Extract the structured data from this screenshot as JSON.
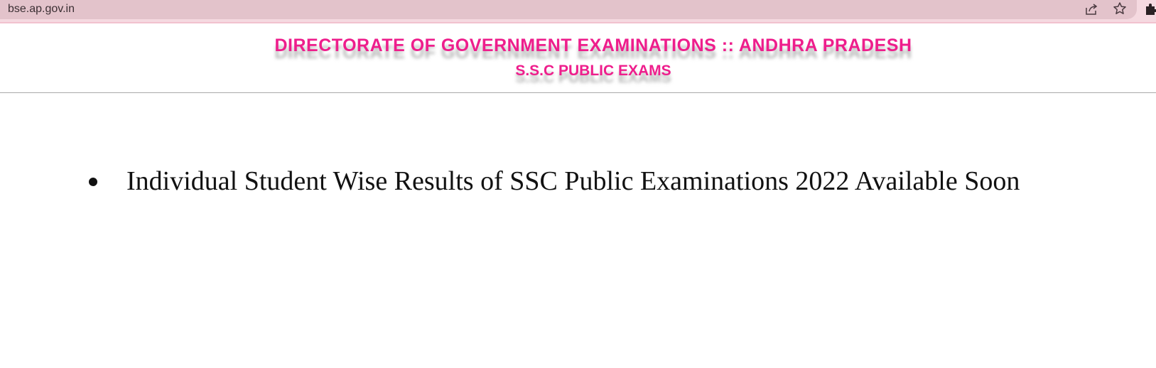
{
  "browser": {
    "url": "bse.ap.gov.in",
    "icons": [
      "lock-icon",
      "share-icon",
      "star-icon",
      "extension-icon"
    ],
    "bar_color": "#f5d9e0",
    "omnibox_color": "#e3c3cb"
  },
  "header": {
    "title": "DIRECTORATE OF GOVERNMENT EXAMINATIONS :: ANDHRA PRADESH",
    "subtitle": "S.S.C PUBLIC EXAMS",
    "title_color": "#ee1e8c"
  },
  "notices": [
    "Individual Student Wise Results of SSC Public Examinations 2022 Available Soon"
  ]
}
